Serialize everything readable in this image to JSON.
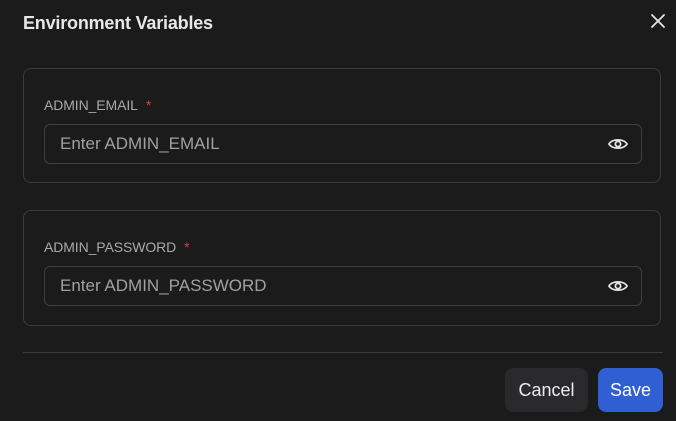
{
  "dialog": {
    "title": "Environment Variables",
    "close_icon": "close-icon"
  },
  "fields": [
    {
      "label": "ADMIN_EMAIL",
      "required_marker": "*",
      "value": "",
      "placeholder": "Enter ADMIN_EMAIL",
      "toggle_icon": "eye-icon"
    },
    {
      "label": "ADMIN_PASSWORD",
      "required_marker": "*",
      "value": "",
      "placeholder": "Enter ADMIN_PASSWORD",
      "toggle_icon": "eye-icon"
    }
  ],
  "actions": {
    "cancel_label": "Cancel",
    "save_label": "Save"
  },
  "colors": {
    "background": "#1b1b1c",
    "required": "#e23b3b",
    "primary": "#2f5fd3",
    "secondary_button": "#2a2a2c"
  }
}
